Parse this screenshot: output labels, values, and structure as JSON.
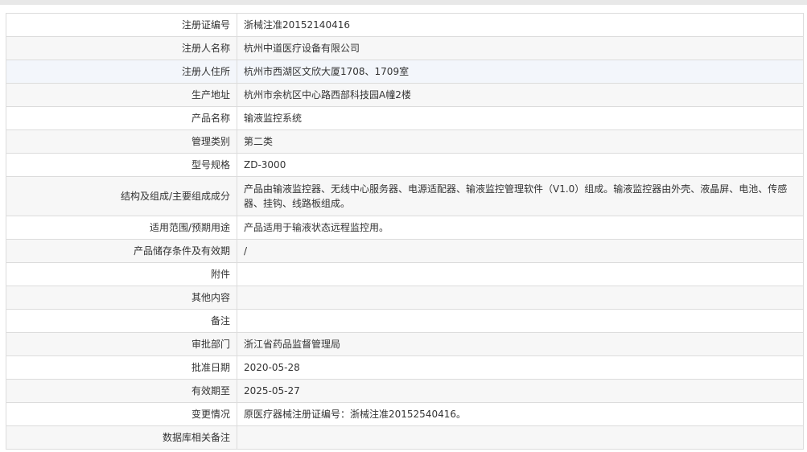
{
  "rows": [
    {
      "label": "注册证编号",
      "value": "浙械注准20152140416"
    },
    {
      "label": "注册人名称",
      "value": "杭州中道医疗设备有限公司"
    },
    {
      "label": "注册人住所",
      "value": "杭州市西湖区文欣大厦1708、1709室"
    },
    {
      "label": "生产地址",
      "value": "杭州市余杭区中心路西部科技园A幢2楼"
    },
    {
      "label": "产品名称",
      "value": "输液监控系统"
    },
    {
      "label": "管理类别",
      "value": "第二类"
    },
    {
      "label": "型号规格",
      "value": "ZD-3000"
    },
    {
      "label": "结构及组成/主要组成成分",
      "value": "产品由输液监控器、无线中心服务器、电源适配器、输液监控管理软件（V1.0）组成。输液监控器由外壳、液晶屏、电池、传感器、挂钩、线路板组成。"
    },
    {
      "label": "适用范围/预期用途",
      "value": "产品适用于输液状态远程监控用。"
    },
    {
      "label": "产品储存条件及有效期",
      "value": "/"
    },
    {
      "label": "附件",
      "value": ""
    },
    {
      "label": "其他内容",
      "value": ""
    },
    {
      "label": "备注",
      "value": ""
    },
    {
      "label": "审批部门",
      "value": "浙江省药品监督管理局"
    },
    {
      "label": "批准日期",
      "value": "2020-05-28"
    },
    {
      "label": "有效期至",
      "value": "2025-05-27"
    },
    {
      "label": "变更情况",
      "value": "原医疗器械注册证编号：浙械注准20152540416。"
    },
    {
      "label": "数据库相关备注",
      "value": ""
    }
  ]
}
